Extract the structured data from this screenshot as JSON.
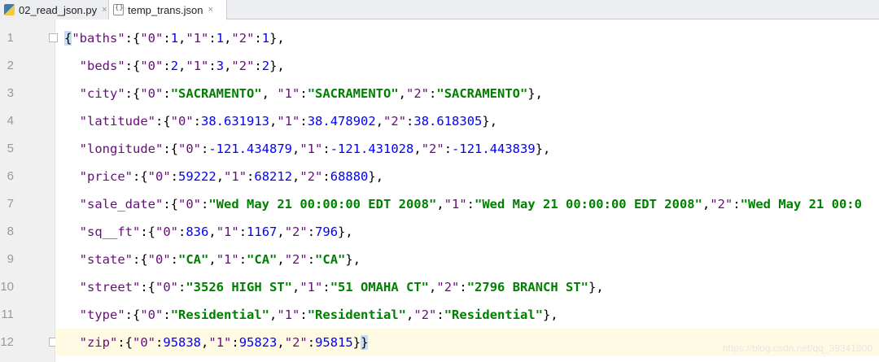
{
  "tabs": [
    {
      "label": "02_read_json.py",
      "icon": "python-file-icon",
      "active": false,
      "close": "×"
    },
    {
      "label": "temp_trans.json",
      "icon": "json-file-icon",
      "active": true,
      "close": "×"
    }
  ],
  "lines": [
    {
      "num": "1",
      "tokens": [
        [
          "b",
          "{"
        ],
        [
          "k",
          "\"baths\""
        ],
        [
          "p",
          ":{"
        ],
        [
          "k",
          "\"0\""
        ],
        [
          "p",
          ":"
        ],
        [
          "n",
          "1"
        ],
        [
          "p",
          ","
        ],
        [
          "k",
          "\"1\""
        ],
        [
          "p",
          ":"
        ],
        [
          "n",
          "1"
        ],
        [
          "p",
          ","
        ],
        [
          "k",
          "\"2\""
        ],
        [
          "p",
          ":"
        ],
        [
          "n",
          "1"
        ],
        [
          "p",
          "},"
        ]
      ]
    },
    {
      "num": "2",
      "tokens": [
        [
          "p",
          "  "
        ],
        [
          "k",
          "\"beds\""
        ],
        [
          "p",
          ":{"
        ],
        [
          "k",
          "\"0\""
        ],
        [
          "p",
          ":"
        ],
        [
          "n",
          "2"
        ],
        [
          "p",
          ","
        ],
        [
          "k",
          "\"1\""
        ],
        [
          "p",
          ":"
        ],
        [
          "n",
          "3"
        ],
        [
          "p",
          ","
        ],
        [
          "k",
          "\"2\""
        ],
        [
          "p",
          ":"
        ],
        [
          "n",
          "2"
        ],
        [
          "p",
          "},"
        ]
      ]
    },
    {
      "num": "3",
      "tokens": [
        [
          "p",
          "  "
        ],
        [
          "k",
          "\"city\""
        ],
        [
          "p",
          ":{"
        ],
        [
          "k",
          "\"0\""
        ],
        [
          "p",
          ":"
        ],
        [
          "s",
          "\"SACRAMENTO\""
        ],
        [
          "p",
          ", "
        ],
        [
          "k",
          "\"1\""
        ],
        [
          "p",
          ":"
        ],
        [
          "s",
          "\"SACRAMENTO\""
        ],
        [
          "p",
          ","
        ],
        [
          "k",
          "\"2\""
        ],
        [
          "p",
          ":"
        ],
        [
          "s",
          "\"SACRAMENTO\""
        ],
        [
          "p",
          "},"
        ]
      ]
    },
    {
      "num": "4",
      "tokens": [
        [
          "p",
          "  "
        ],
        [
          "k",
          "\"latitude\""
        ],
        [
          "p",
          ":{"
        ],
        [
          "k",
          "\"0\""
        ],
        [
          "p",
          ":"
        ],
        [
          "n",
          "38.631913"
        ],
        [
          "p",
          ","
        ],
        [
          "k",
          "\"1\""
        ],
        [
          "p",
          ":"
        ],
        [
          "n",
          "38.478902"
        ],
        [
          "p",
          ","
        ],
        [
          "k",
          "\"2\""
        ],
        [
          "p",
          ":"
        ],
        [
          "n",
          "38.618305"
        ],
        [
          "p",
          "},"
        ]
      ]
    },
    {
      "num": "5",
      "tokens": [
        [
          "p",
          "  "
        ],
        [
          "k",
          "\"longitude\""
        ],
        [
          "p",
          ":{"
        ],
        [
          "k",
          "\"0\""
        ],
        [
          "p",
          ":"
        ],
        [
          "n",
          "-121.434879"
        ],
        [
          "p",
          ","
        ],
        [
          "k",
          "\"1\""
        ],
        [
          "p",
          ":"
        ],
        [
          "n",
          "-121.431028"
        ],
        [
          "p",
          ","
        ],
        [
          "k",
          "\"2\""
        ],
        [
          "p",
          ":"
        ],
        [
          "n",
          "-121.443839"
        ],
        [
          "p",
          "},"
        ]
      ]
    },
    {
      "num": "6",
      "tokens": [
        [
          "p",
          "  "
        ],
        [
          "k",
          "\"price\""
        ],
        [
          "p",
          ":{"
        ],
        [
          "k",
          "\"0\""
        ],
        [
          "p",
          ":"
        ],
        [
          "n",
          "59222"
        ],
        [
          "p",
          ","
        ],
        [
          "k",
          "\"1\""
        ],
        [
          "p",
          ":"
        ],
        [
          "n",
          "68212"
        ],
        [
          "p",
          ","
        ],
        [
          "k",
          "\"2\""
        ],
        [
          "p",
          ":"
        ],
        [
          "n",
          "68880"
        ],
        [
          "p",
          "},"
        ]
      ]
    },
    {
      "num": "7",
      "tokens": [
        [
          "p",
          "  "
        ],
        [
          "k",
          "\"sale_date\""
        ],
        [
          "p",
          ":{"
        ],
        [
          "k",
          "\"0\""
        ],
        [
          "p",
          ":"
        ],
        [
          "s",
          "\"Wed May 21 00:00:00 EDT 2008\""
        ],
        [
          "p",
          ","
        ],
        [
          "k",
          "\"1\""
        ],
        [
          "p",
          ":"
        ],
        [
          "s",
          "\"Wed May 21 00:00:00 EDT 2008\""
        ],
        [
          "p",
          ","
        ],
        [
          "k",
          "\"2\""
        ],
        [
          "p",
          ":"
        ],
        [
          "s",
          "\"Wed May 21 00:0"
        ]
      ]
    },
    {
      "num": "8",
      "tokens": [
        [
          "p",
          "  "
        ],
        [
          "k",
          "\"sq__ft\""
        ],
        [
          "p",
          ":{"
        ],
        [
          "k",
          "\"0\""
        ],
        [
          "p",
          ":"
        ],
        [
          "n",
          "836"
        ],
        [
          "p",
          ","
        ],
        [
          "k",
          "\"1\""
        ],
        [
          "p",
          ":"
        ],
        [
          "n",
          "1167"
        ],
        [
          "p",
          ","
        ],
        [
          "k",
          "\"2\""
        ],
        [
          "p",
          ":"
        ],
        [
          "n",
          "796"
        ],
        [
          "p",
          "},"
        ]
      ]
    },
    {
      "num": "9",
      "tokens": [
        [
          "p",
          "  "
        ],
        [
          "k",
          "\"state\""
        ],
        [
          "p",
          ":{"
        ],
        [
          "k",
          "\"0\""
        ],
        [
          "p",
          ":"
        ],
        [
          "s",
          "\"CA\""
        ],
        [
          "p",
          ","
        ],
        [
          "k",
          "\"1\""
        ],
        [
          "p",
          ":"
        ],
        [
          "s",
          "\"CA\""
        ],
        [
          "p",
          ","
        ],
        [
          "k",
          "\"2\""
        ],
        [
          "p",
          ":"
        ],
        [
          "s",
          "\"CA\""
        ],
        [
          "p",
          "},"
        ]
      ]
    },
    {
      "num": "10",
      "tokens": [
        [
          "p",
          "  "
        ],
        [
          "k",
          "\"street\""
        ],
        [
          "p",
          ":{"
        ],
        [
          "k",
          "\"0\""
        ],
        [
          "p",
          ":"
        ],
        [
          "s",
          "\"3526 HIGH ST\""
        ],
        [
          "p",
          ","
        ],
        [
          "k",
          "\"1\""
        ],
        [
          "p",
          ":"
        ],
        [
          "s",
          "\"51 OMAHA CT\""
        ],
        [
          "p",
          ","
        ],
        [
          "k",
          "\"2\""
        ],
        [
          "p",
          ":"
        ],
        [
          "s",
          "\"2796 BRANCH ST\""
        ],
        [
          "p",
          "},"
        ]
      ]
    },
    {
      "num": "11",
      "tokens": [
        [
          "p",
          "  "
        ],
        [
          "k",
          "\"type\""
        ],
        [
          "p",
          ":{"
        ],
        [
          "k",
          "\"0\""
        ],
        [
          "p",
          ":"
        ],
        [
          "s",
          "\"Residential\""
        ],
        [
          "p",
          ","
        ],
        [
          "k",
          "\"1\""
        ],
        [
          "p",
          ":"
        ],
        [
          "s",
          "\"Residential\""
        ],
        [
          "p",
          ","
        ],
        [
          "k",
          "\"2\""
        ],
        [
          "p",
          ":"
        ],
        [
          "s",
          "\"Residential\""
        ],
        [
          "p",
          "},"
        ]
      ]
    },
    {
      "num": "12",
      "tokens": [
        [
          "p",
          "  "
        ],
        [
          "k",
          "\"zip\""
        ],
        [
          "p",
          ":{"
        ],
        [
          "k",
          "\"0\""
        ],
        [
          "p",
          ":"
        ],
        [
          "n",
          "95838"
        ],
        [
          "p",
          ","
        ],
        [
          "k",
          "\"1\""
        ],
        [
          "p",
          ":"
        ],
        [
          "n",
          "95823"
        ],
        [
          "p",
          ","
        ],
        [
          "k",
          "\"2\""
        ],
        [
          "p",
          ":"
        ],
        [
          "n",
          "95815"
        ],
        [
          "p",
          "}"
        ],
        [
          "b",
          "}"
        ]
      ]
    }
  ],
  "watermark": "https://blog.csdn.net/qq_39341800",
  "colors": {
    "key": "#660e7a",
    "string": "#008000",
    "number": "#0000ff",
    "current_line": "#fffae3",
    "brace_highlight": "#c6dcf7"
  }
}
